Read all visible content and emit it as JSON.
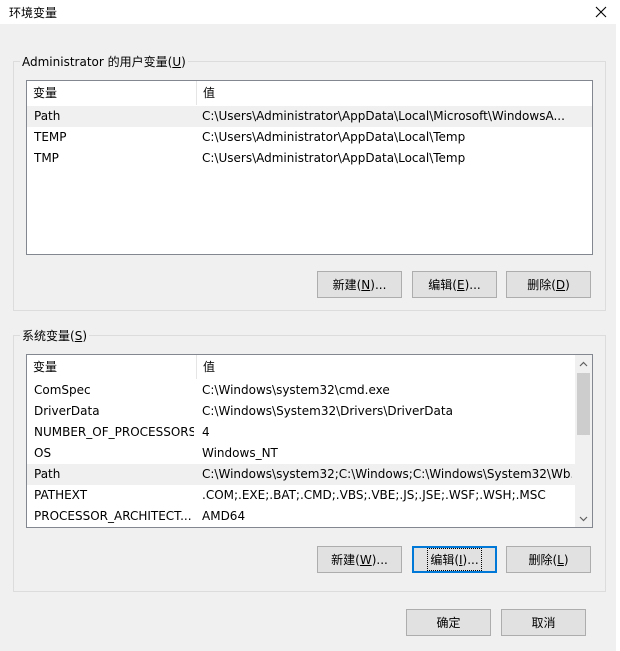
{
  "window": {
    "title": "环境变量",
    "close_icon": "close-icon"
  },
  "user_vars": {
    "label": "Administrator 的用户变量(U)",
    "columns": [
      "变量",
      "值"
    ],
    "rows": [
      {
        "name": "Path",
        "value": "C:\\Users\\Administrator\\AppData\\Local\\Microsoft\\WindowsA..."
      },
      {
        "name": "TEMP",
        "value": "C:\\Users\\Administrator\\AppData\\Local\\Temp"
      },
      {
        "name": "TMP",
        "value": "C:\\Users\\Administrator\\AppData\\Local\\Temp"
      }
    ],
    "selected_row": 0,
    "buttons": {
      "new": {
        "prefix": "新建(",
        "key": "N",
        "suffix": ")..."
      },
      "edit": {
        "prefix": "编辑(",
        "key": "E",
        "suffix": ")..."
      },
      "delete": {
        "prefix": "删除(",
        "key": "D",
        "suffix": ")"
      }
    }
  },
  "system_vars": {
    "label": "系统变量(S)",
    "columns": [
      "变量",
      "值"
    ],
    "rows": [
      {
        "name": "ComSpec",
        "value": "C:\\Windows\\system32\\cmd.exe"
      },
      {
        "name": "DriverData",
        "value": "C:\\Windows\\System32\\Drivers\\DriverData"
      },
      {
        "name": "NUMBER_OF_PROCESSORS",
        "value": "4"
      },
      {
        "name": "OS",
        "value": "Windows_NT"
      },
      {
        "name": "Path",
        "value": "C:\\Windows\\system32;C:\\Windows;C:\\Windows\\System32\\Wb..."
      },
      {
        "name": "PATHEXT",
        "value": ".COM;.EXE;.BAT;.CMD;.VBS;.VBE;.JS;.JSE;.WSF;.WSH;.MSC"
      },
      {
        "name": "PROCESSOR_ARCHITECT...",
        "value": "AMD64"
      }
    ],
    "selected_row": 4,
    "buttons": {
      "new": {
        "prefix": "新建(",
        "key": "W",
        "suffix": ")..."
      },
      "edit": {
        "prefix": "编辑(",
        "key": "I",
        "suffix": ")..."
      },
      "delete": {
        "prefix": "删除(",
        "key": "L",
        "suffix": ")"
      }
    }
  },
  "footer": {
    "ok": "确定",
    "cancel": "取消"
  },
  "colors": {
    "focus_border": "#0078d7",
    "selected_row": "#f0f0f0",
    "dialog_bg": "#f0f0f0"
  }
}
